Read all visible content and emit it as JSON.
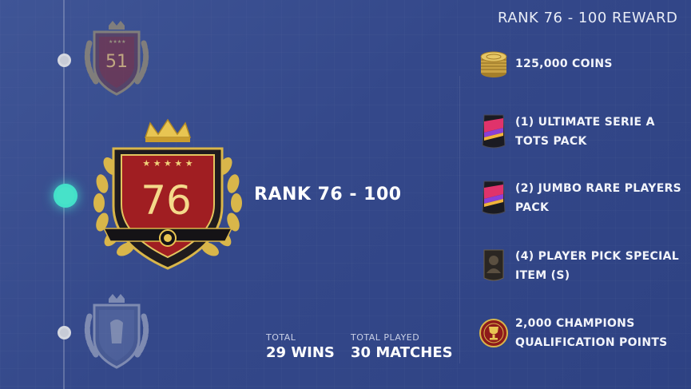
{
  "timeline": {
    "prev_rank_number": "51",
    "current_rank_number": "76"
  },
  "rank": {
    "title": "RANK 76 - 100"
  },
  "stats": {
    "total_label": "TOTAL",
    "total_value": "29 WINS",
    "played_label": "TOTAL PLAYED",
    "played_value": "30 MATCHES"
  },
  "rewards": {
    "header": "RANK 76 - 100 REWARD",
    "items": [
      {
        "icon": "coins-icon",
        "label": "125,000 COINS"
      },
      {
        "icon": "pack-icon",
        "label": "(1) ULTIMATE SERIE A TOTS PACK"
      },
      {
        "icon": "pack-icon",
        "label": "(2) JUMBO RARE PLAYERS PACK"
      },
      {
        "icon": "player-card-icon",
        "label": "(4) PLAYER PICK SPECIAL ITEM (S)"
      },
      {
        "icon": "champions-points-icon",
        "label": "2,000 CHAMPIONS QUALIFICATION POINTS"
      }
    ]
  },
  "colors": {
    "background": "#3a4f91",
    "active_dot": "#47e2c9",
    "badge_red": "#8e1a1a",
    "badge_gold": "#d9b64a"
  }
}
